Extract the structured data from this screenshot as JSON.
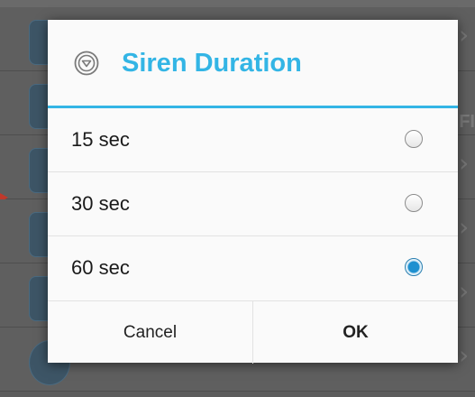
{
  "dialog": {
    "title": "Siren Duration",
    "header_icon": "chevron-down-circle-icon",
    "accent_color": "#33b5e5",
    "options": [
      {
        "label": "15 sec",
        "selected": false
      },
      {
        "label": "30 sec",
        "selected": false
      },
      {
        "label": "60 sec",
        "selected": true
      }
    ],
    "cancel_label": "Cancel",
    "ok_label": "OK"
  },
  "background": {
    "partial_text": "FI"
  }
}
